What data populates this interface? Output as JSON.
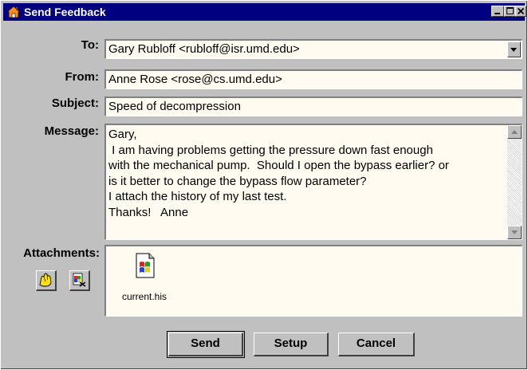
{
  "window": {
    "title": "Send Feedback",
    "minimize_icon": "minimize-icon",
    "maximize_icon": "maximize-icon",
    "close_icon": "close-icon"
  },
  "form": {
    "to_label": "To:",
    "to_value": "Gary Rubloff <rubloff@isr.umd.edu>",
    "from_label": "From:",
    "from_value": "Anne Rose <rose@cs.umd.edu>",
    "subject_label": "Subject:",
    "subject_value": "Speed of decompression",
    "message_label": "Message:",
    "message_value": "Gary,\n I am having problems getting the pressure down fast enough\nwith the mechanical pump.  Should I open the bypass earlier? or\nis it better to change the bypass flow parameter?\nI attach the history of my last test.\nThanks!   Anne",
    "attachments_label": "Attachments:"
  },
  "attachments": [
    {
      "name": "current.his",
      "icon": "windows-file-icon"
    }
  ],
  "attachment_tools": {
    "attach_icon": "hand-attach-icon",
    "remove_icon": "file-remove-icon"
  },
  "buttons": {
    "send": "Send",
    "setup": "Setup",
    "cancel": "Cancel"
  },
  "colors": {
    "titlebar": "#000080",
    "face": "#c0c0c0",
    "field_bg": "#fffbf0"
  }
}
